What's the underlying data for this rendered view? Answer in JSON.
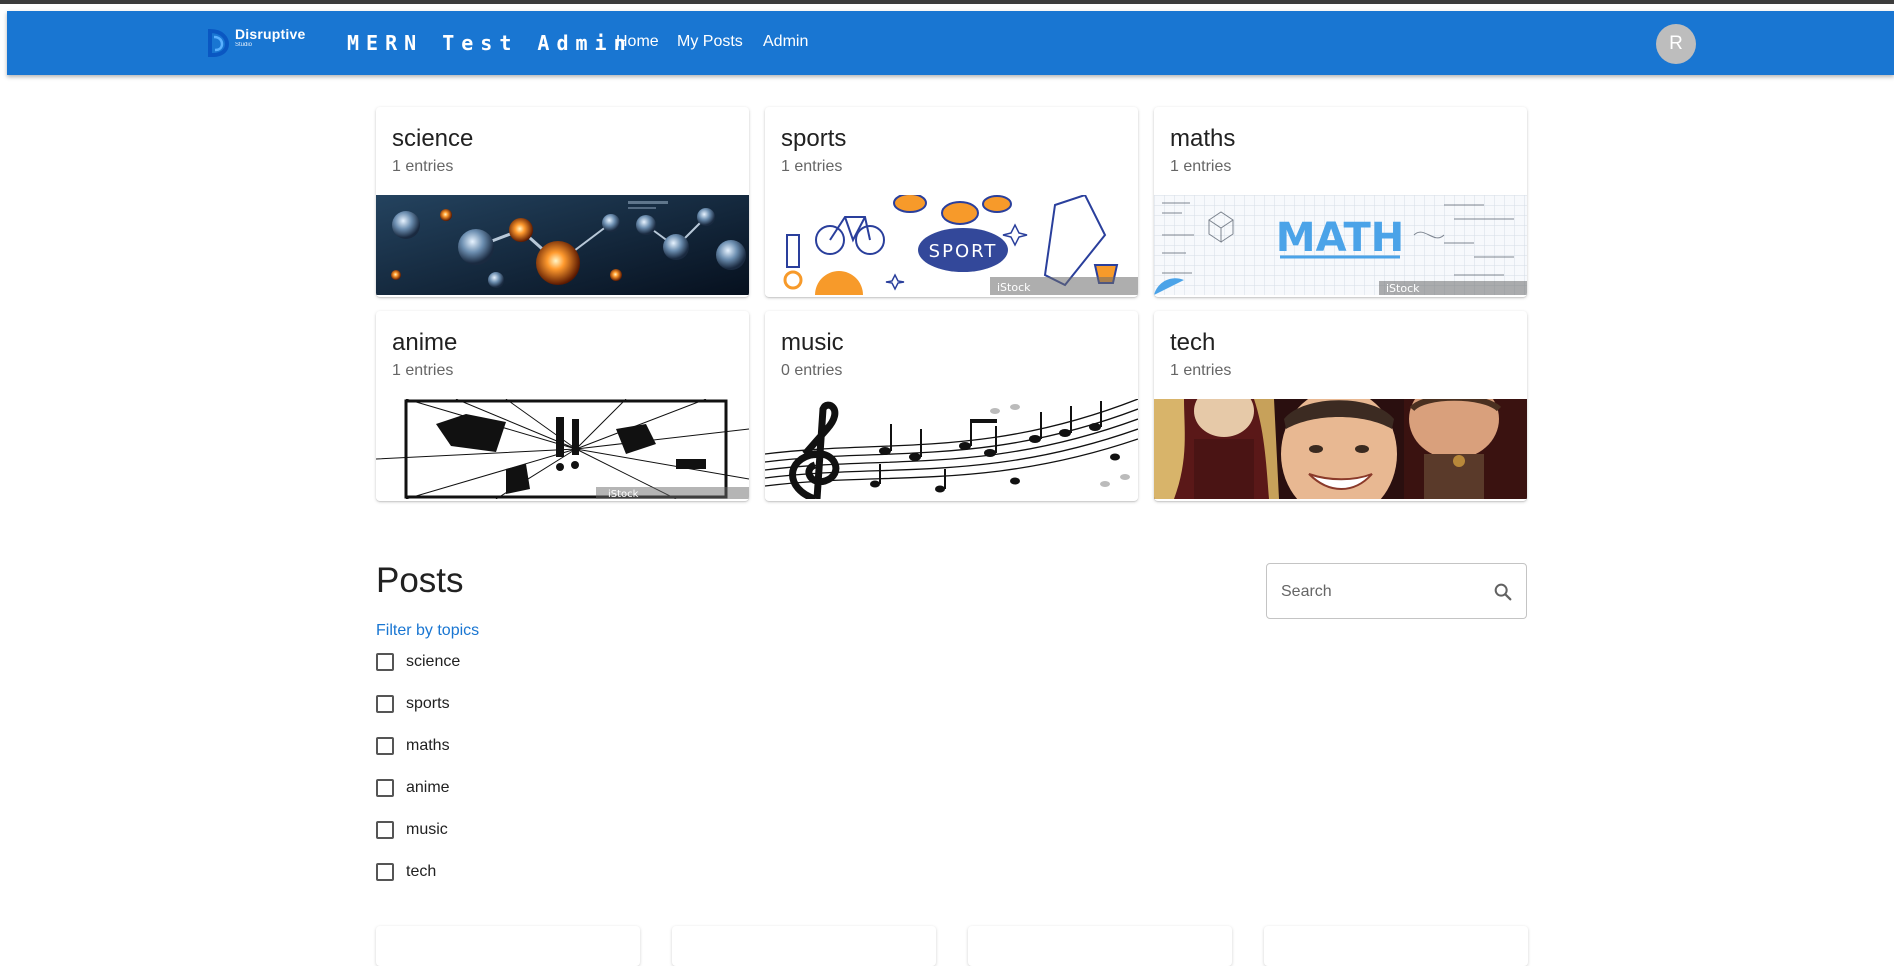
{
  "appbar": {
    "logo_text": "Disruptive",
    "logo_sub": "Studio",
    "title": "MERN Test Admin",
    "nav": {
      "home": "Home",
      "my_posts": "My Posts",
      "admin": "Admin"
    },
    "avatar_initial": "R"
  },
  "topics": [
    {
      "name": "science",
      "entries": "1 entries",
      "image": "molecules-image"
    },
    {
      "name": "sports",
      "entries": "1 entries",
      "image": "sport-doodle-image",
      "watermark": "iStock"
    },
    {
      "name": "maths",
      "entries": "1 entries",
      "image": "math-board-image",
      "image_text": "MATH",
      "watermark": "iStock"
    },
    {
      "name": "anime",
      "entries": "1 entries",
      "image": "manga-panel-image",
      "watermark": "iStock"
    },
    {
      "name": "music",
      "entries": "0 entries",
      "image": "music-notes-image"
    },
    {
      "name": "tech",
      "entries": "1 entries",
      "image": "group-photo-image"
    }
  ],
  "posts": {
    "heading": "Posts",
    "filter_label": "Filter by topics",
    "filters": [
      {
        "label": "science",
        "checked": false
      },
      {
        "label": "sports",
        "checked": false
      },
      {
        "label": "maths",
        "checked": false
      },
      {
        "label": "anime",
        "checked": false
      },
      {
        "label": "music",
        "checked": false
      },
      {
        "label": "tech",
        "checked": false
      }
    ]
  },
  "search": {
    "placeholder": "Search",
    "value": ""
  },
  "colors": {
    "appbar": "#1976d2",
    "link": "#1976d2",
    "avatar": "#bdbdbd"
  }
}
